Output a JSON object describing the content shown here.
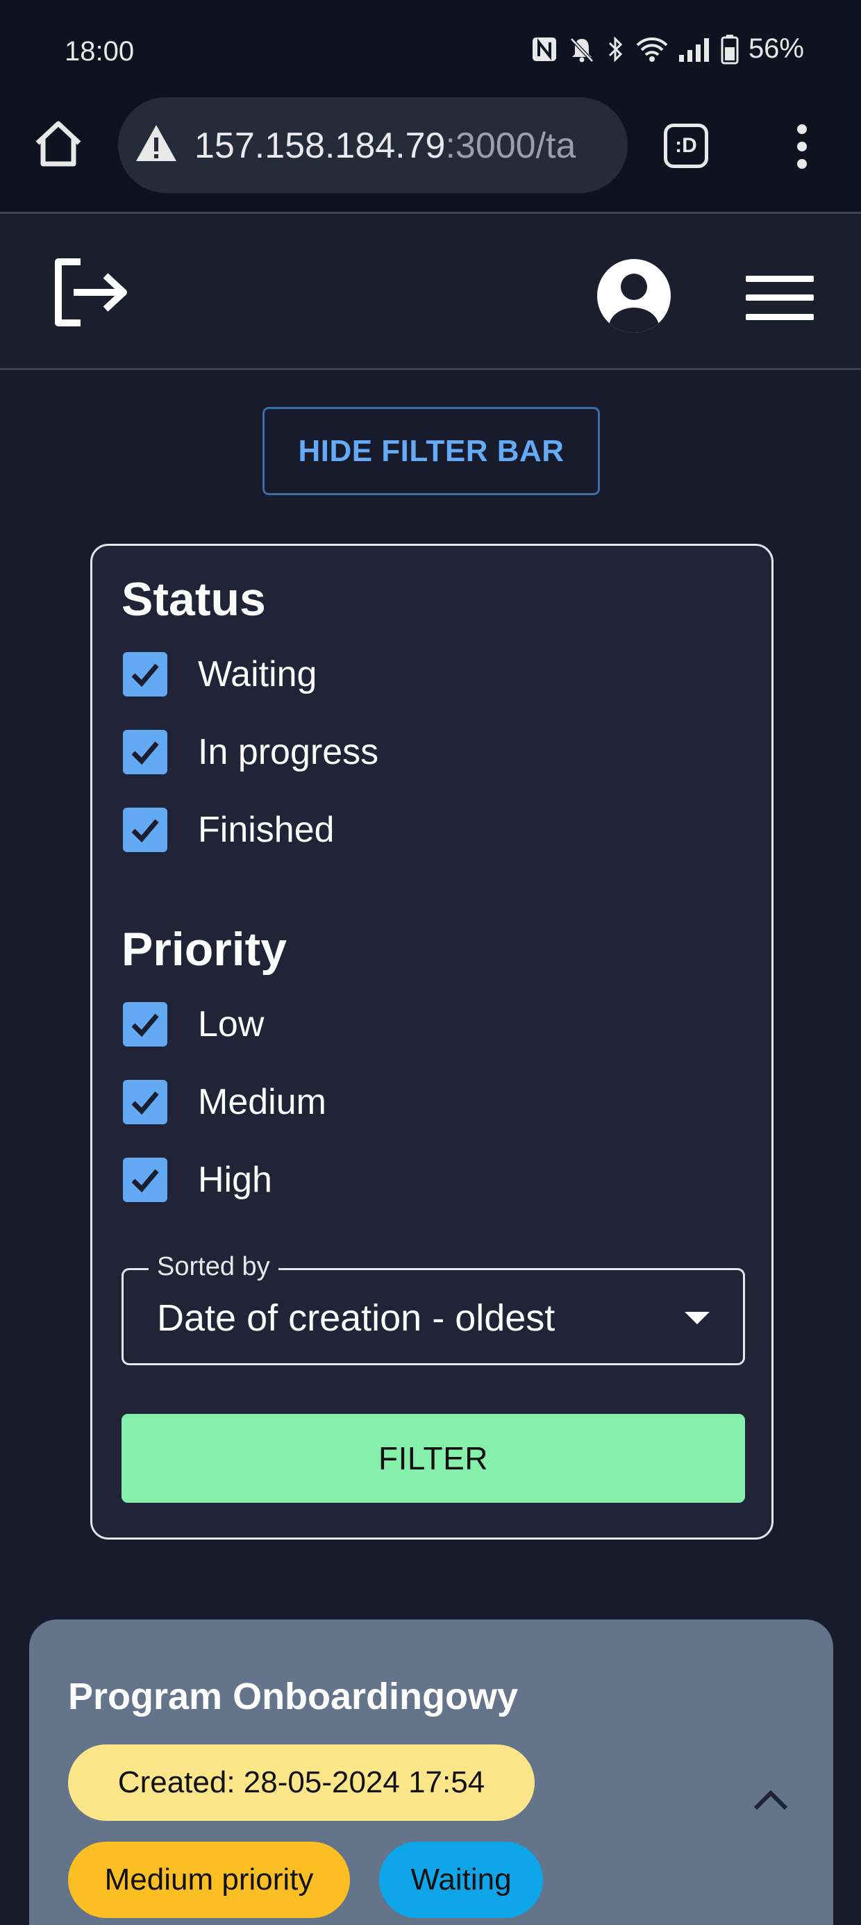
{
  "status_bar": {
    "time": "18:00",
    "battery": "56%",
    "icons": [
      "nfc-icon",
      "bell-off-icon",
      "bluetooth-icon",
      "wifi-icon",
      "signal-icon",
      "battery-icon"
    ]
  },
  "browser": {
    "url_host": "157.158.184.79",
    "url_rest": ":3000/ta",
    "tab_switcher_label": ":D",
    "icons": [
      "home-icon",
      "warning-icon",
      "more-vert-icon"
    ]
  },
  "header": {
    "icons": [
      "logout-icon",
      "account-icon",
      "menu-icon"
    ]
  },
  "hide_filter_button": "HIDE FILTER BAR",
  "filters": {
    "status_title": "Status",
    "status_options": [
      {
        "label": "Waiting",
        "checked": true
      },
      {
        "label": "In progress",
        "checked": true
      },
      {
        "label": "Finished",
        "checked": true
      }
    ],
    "priority_title": "Priority",
    "priority_options": [
      {
        "label": "Low",
        "checked": true
      },
      {
        "label": "Medium",
        "checked": true
      },
      {
        "label": "High",
        "checked": true
      }
    ],
    "sort_label": "Sorted by",
    "sort_value": "Date of creation - oldest",
    "filter_button": "FILTER"
  },
  "tasks": [
    {
      "title": "Program Onboardingowy",
      "created": "Created: 28-05-2024 17:54",
      "priority": "Medium priority",
      "status": "Waiting"
    }
  ],
  "colors": {
    "background": "#171b2b",
    "accent_blue": "#63a8f2",
    "filter_green": "#86efac",
    "card_slate": "#64748b",
    "chip_created": "#fde68a",
    "chip_priority": "#fbbf24",
    "chip_status": "#0ea5e9"
  }
}
